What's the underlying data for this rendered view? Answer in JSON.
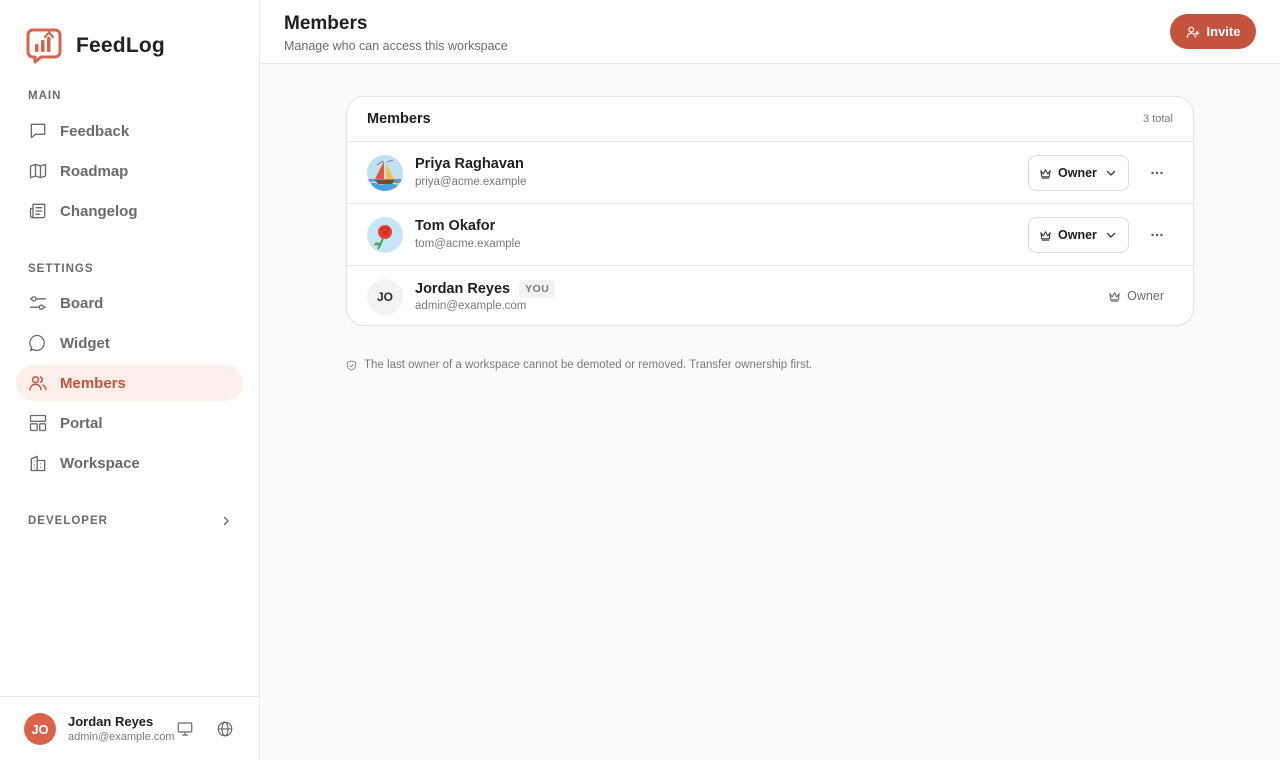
{
  "app": {
    "name": "FeedLog",
    "accent": "#c4533d",
    "accent_bg": "#fdeee9"
  },
  "sidebar": {
    "sections": [
      {
        "label": "MAIN",
        "items": [
          {
            "label": "Feedback",
            "icon": "message-square-icon"
          },
          {
            "label": "Roadmap",
            "icon": "map-icon"
          },
          {
            "label": "Changelog",
            "icon": "newspaper-icon"
          }
        ]
      },
      {
        "label": "SETTINGS",
        "items": [
          {
            "label": "Board",
            "icon": "sliders-icon"
          },
          {
            "label": "Widget",
            "icon": "message-circle-icon"
          },
          {
            "label": "Members",
            "icon": "users-icon",
            "active": true
          },
          {
            "label": "Portal",
            "icon": "layout-icon"
          },
          {
            "label": "Workspace",
            "icon": "building-icon"
          }
        ]
      }
    ],
    "developer_label": "DEVELOPER",
    "user": {
      "initials": "JO",
      "name": "Jordan Reyes",
      "email": "admin@example.com"
    }
  },
  "header": {
    "title": "Members",
    "subtitle": "Manage who can access this workspace",
    "invite_label": "Invite"
  },
  "members_card": {
    "title": "Members",
    "count_label": "3 total",
    "members": [
      {
        "name": "Priya Raghavan",
        "email": "priya@acme.example",
        "role": "Owner",
        "avatar": "sailboat-avatar",
        "editable": true
      },
      {
        "name": "Tom Okafor",
        "email": "tom@acme.example",
        "role": "Owner",
        "avatar": "rose-avatar",
        "editable": true
      },
      {
        "name": "Jordan Reyes",
        "email": "admin@example.com",
        "role": "Owner",
        "initials": "JO",
        "badge": "YOU",
        "editable": false
      }
    ]
  },
  "note": "The last owner of a workspace cannot be demoted or removed. Transfer ownership first."
}
